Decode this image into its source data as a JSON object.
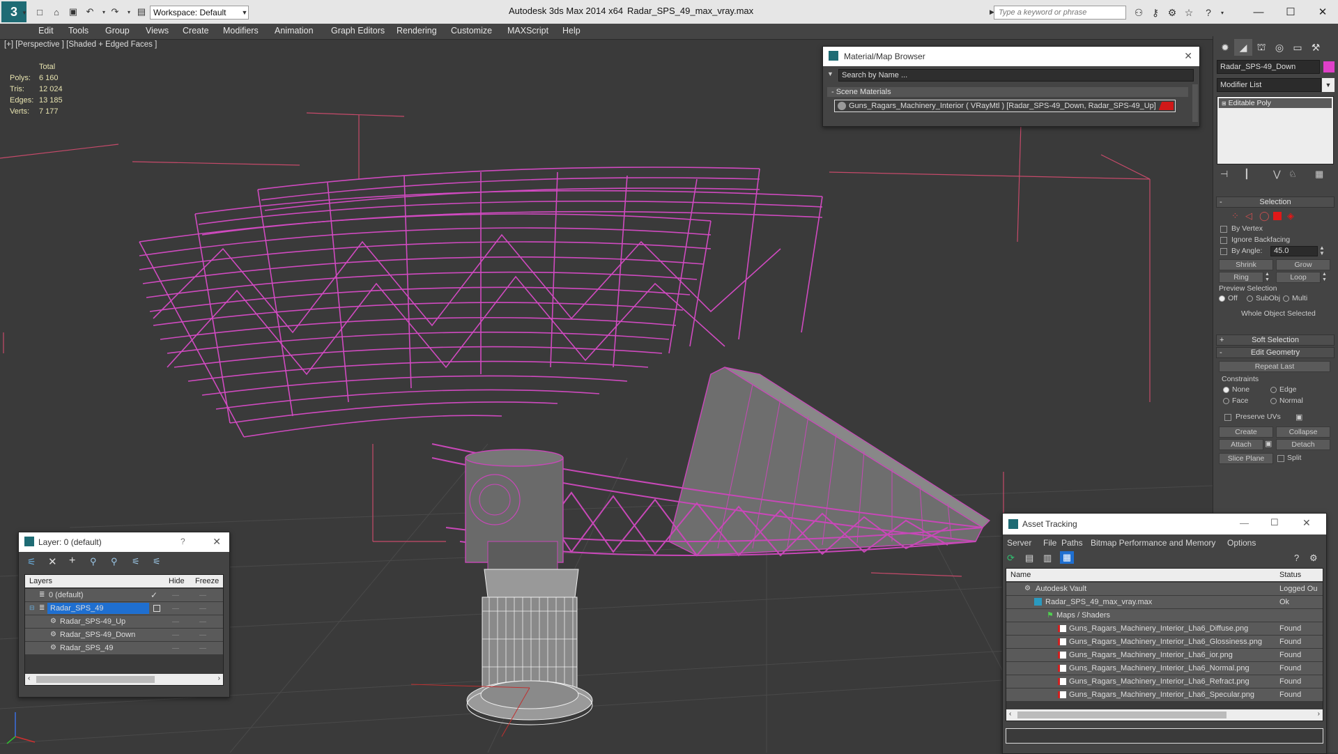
{
  "app": {
    "title": "Autodesk 3ds Max  2014 x64",
    "file": "Radar_SPS_49_max_vray.max",
    "workspace": "Workspace: Default",
    "search_placeholder": "Type a keyword or phrase"
  },
  "menu": [
    "Edit",
    "Tools",
    "Group",
    "Views",
    "Create",
    "Modifiers",
    "Animation",
    "Graph Editors",
    "Rendering",
    "Customize",
    "MAXScript",
    "Help"
  ],
  "viewport": {
    "label": "[+] [Perspective ] [Shaded + Edged Faces ]",
    "stats_header": "Total",
    "stats": [
      {
        "k": "Polys:",
        "v": "6 160"
      },
      {
        "k": "Tris:",
        "v": "12 024"
      },
      {
        "k": "Edges:",
        "v": "13 185"
      },
      {
        "k": "Verts:",
        "v": "7 177"
      }
    ]
  },
  "command_panel": {
    "object_name": "Radar_SPS-49_Down",
    "modifier_list": "Modifier List",
    "stack_item": "Editable Poly",
    "selection_title": "Selection",
    "by_vertex": "By Vertex",
    "ignore_backfacing": "Ignore Backfacing",
    "by_angle": "By Angle:",
    "angle_value": "45.0",
    "shrink": "Shrink",
    "grow": "Grow",
    "ring": "Ring",
    "loop": "Loop",
    "preview_selection": "Preview Selection",
    "off": "Off",
    "subobj": "SubObj",
    "multi": "Multi",
    "whole_object": "Whole Object Selected",
    "soft_selection": "Soft Selection",
    "edit_geometry": "Edit Geometry",
    "repeat_last": "Repeat Last",
    "constraints": "Constraints",
    "none": "None",
    "edge": "Edge",
    "face": "Face",
    "normal": "Normal",
    "preserve_uvs": "Preserve UVs",
    "create": "Create",
    "collapse": "Collapse",
    "attach": "Attach",
    "detach": "Detach",
    "slice_plane": "Slice Plane",
    "split": "Split",
    "accent": "#e040c8"
  },
  "material_browser": {
    "title": "Material/Map Browser",
    "search": "Search by Name ...",
    "section": "- Scene Materials",
    "material": "Guns_Ragars_Machinery_Interior  ( VRayMtl ) [Radar_SPS-49_Down, Radar_SPS-49_Up]",
    "swatch": "#d01818"
  },
  "layer_window": {
    "title": "Layer: 0 (default)",
    "help": "?",
    "col_layers": "Layers",
    "col_hide": "Hide",
    "col_freeze": "Freeze",
    "rows": [
      {
        "name": "0 (default)",
        "indent": 0,
        "selected": false
      },
      {
        "name": "Radar_SPS_49",
        "indent": 0,
        "selected": true
      },
      {
        "name": "Radar_SPS-49_Up",
        "indent": 1,
        "selected": false
      },
      {
        "name": "Radar_SPS-49_Down",
        "indent": 1,
        "selected": false
      },
      {
        "name": "Radar_SPS_49",
        "indent": 1,
        "selected": false
      }
    ]
  },
  "asset_tracking": {
    "title": "Asset Tracking",
    "menu": [
      "Server",
      "File",
      "Paths",
      "Bitmap Performance and Memory",
      "Options"
    ],
    "col_name": "Name",
    "col_status": "Status",
    "rows": [
      {
        "name": "Autodesk Vault",
        "status": "Logged Ou",
        "indent": 1
      },
      {
        "name": "Radar_SPS_49_max_vray.max",
        "status": "Ok",
        "indent": 2
      },
      {
        "name": "Maps / Shaders",
        "status": "",
        "indent": 3
      },
      {
        "name": "Guns_Ragars_Machinery_Interior_Lha6_Diffuse.png",
        "status": "Found",
        "indent": 4
      },
      {
        "name": "Guns_Ragars_Machinery_Interior_Lha6_Glossiness.png",
        "status": "Found",
        "indent": 4
      },
      {
        "name": "Guns_Ragars_Machinery_Interior_Lha6_ior.png",
        "status": "Found",
        "indent": 4
      },
      {
        "name": "Guns_Ragars_Machinery_Interior_Lha6_Normal.png",
        "status": "Found",
        "indent": 4
      },
      {
        "name": "Guns_Ragars_Machinery_Interior_Lha6_Refract.png",
        "status": "Found",
        "indent": 4
      },
      {
        "name": "Guns_Ragars_Machinery_Interior_Lha6_Specular.png",
        "status": "Found",
        "indent": 4
      }
    ]
  }
}
